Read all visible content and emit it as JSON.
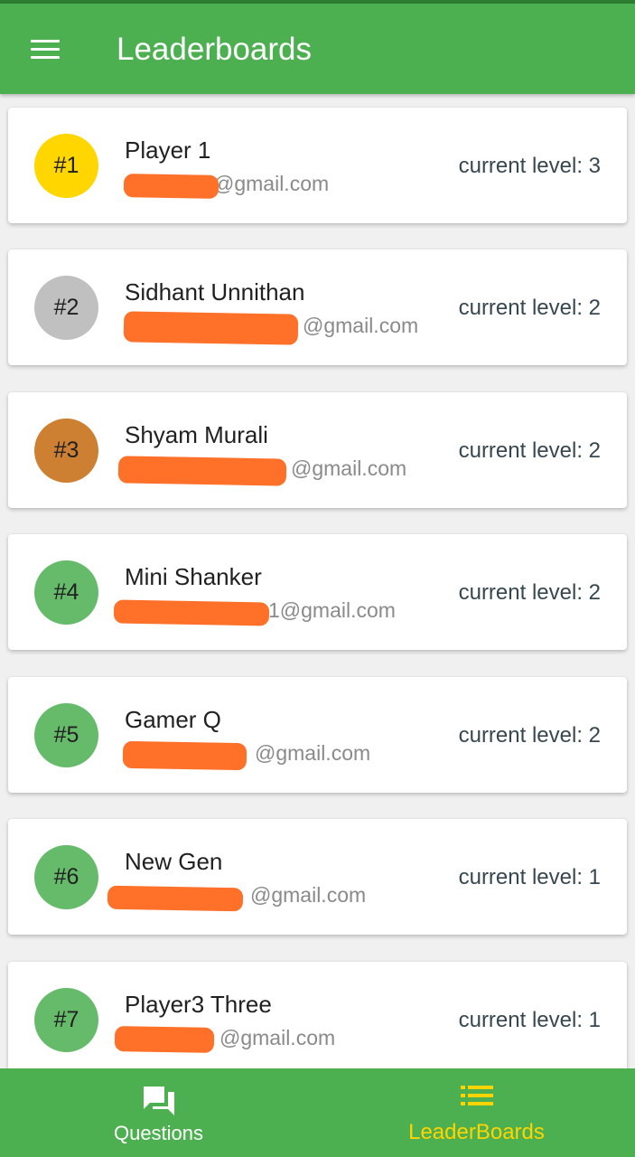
{
  "app_bar": {
    "title": "Leaderboards",
    "menu_icon": "hamburger-menu-icon"
  },
  "colors": {
    "primary": "#4caf50",
    "gold": "#ffd600",
    "silver": "#c0c0c0",
    "bronze": "#cd7f32",
    "default_rank": "#66bb6a",
    "active_tab": "#ffd400",
    "redaction": "#ff7029"
  },
  "leaderboard": [
    {
      "rank": "#1",
      "name": "Player 1",
      "email": "@gmail.com",
      "level": "current level: 3"
    },
    {
      "rank": "#2",
      "name": "Sidhant Unnithan",
      "email": "@gmail.com",
      "level": "current level: 2"
    },
    {
      "rank": "#3",
      "name": "Shyam Murali",
      "email": "@gmail.com",
      "level": "current level: 2"
    },
    {
      "rank": "#4",
      "name": "Mini Shanker",
      "email": "1@gmail.com",
      "level": "current level: 2"
    },
    {
      "rank": "#5",
      "name": "Gamer Q",
      "email": "@gmail.com",
      "level": "current level: 2"
    },
    {
      "rank": "#6",
      "name": "New Gen",
      "email": "@gmail.com",
      "level": "current level: 1"
    },
    {
      "rank": "#7",
      "name": "Player3 Three",
      "email": "@gmail.com",
      "level": "current level: 1"
    }
  ],
  "bottom_nav": {
    "questions": {
      "label": "Questions",
      "icon": "chat-bubbles-icon",
      "active": false
    },
    "leaderboards": {
      "label": "LeaderBoards",
      "icon": "list-icon",
      "active": true
    }
  }
}
